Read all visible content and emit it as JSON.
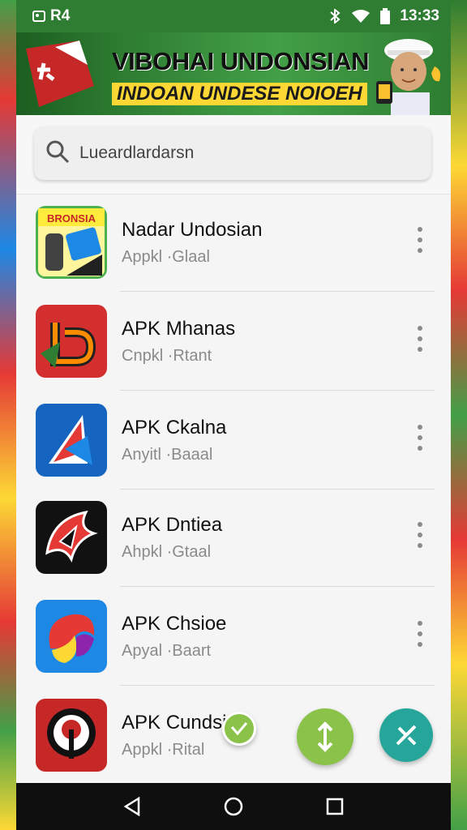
{
  "status_bar": {
    "carrier": "R4",
    "time": "13:33",
    "icons": [
      "image-icon",
      "sim-icon",
      "bluetooth-icon",
      "wifi-icon",
      "battery-icon"
    ]
  },
  "banner": {
    "title": "VIBOHAI UNDONSIAN",
    "subtitle": "INDOAN UNDESE NOIOEH",
    "colors": {
      "background": "#2e7d32",
      "highlight": "#fdd835",
      "flag_red": "#e53935"
    }
  },
  "search": {
    "placeholder": "Lueardlardarsn",
    "value": ""
  },
  "apps": [
    {
      "name": "Nadar Undosian",
      "subtitle": "Appkl ·Glaal",
      "icon": "app-icon-bronsia",
      "icon_text": "BRONSIA"
    },
    {
      "name": "APK Mhanas",
      "subtitle": "Cnpkl ·Rtant",
      "icon": "app-icon-b-logo"
    },
    {
      "name": "APK Ckalna",
      "subtitle": "Anyitl ·Baaal",
      "icon": "app-icon-a-logo"
    },
    {
      "name": "APK Dntiea",
      "subtitle": "Ahpkl ·Gtaal",
      "icon": "app-icon-bird-logo"
    },
    {
      "name": "APK Chsioe",
      "subtitle": "Apyal ·Baart",
      "icon": "app-icon-swirl-logo"
    },
    {
      "name": "APK Cundsi",
      "subtitle": "Appkl ·Rital",
      "icon": "app-icon-pin-logo"
    }
  ],
  "fabs": [
    {
      "name": "check-icon",
      "color": "#8bc34a"
    },
    {
      "name": "swap-vertical-icon",
      "color": "#8bc34a"
    },
    {
      "name": "tools-icon",
      "color": "#26a69a"
    }
  ],
  "nav": [
    "back-icon",
    "home-icon",
    "recents-icon"
  ]
}
